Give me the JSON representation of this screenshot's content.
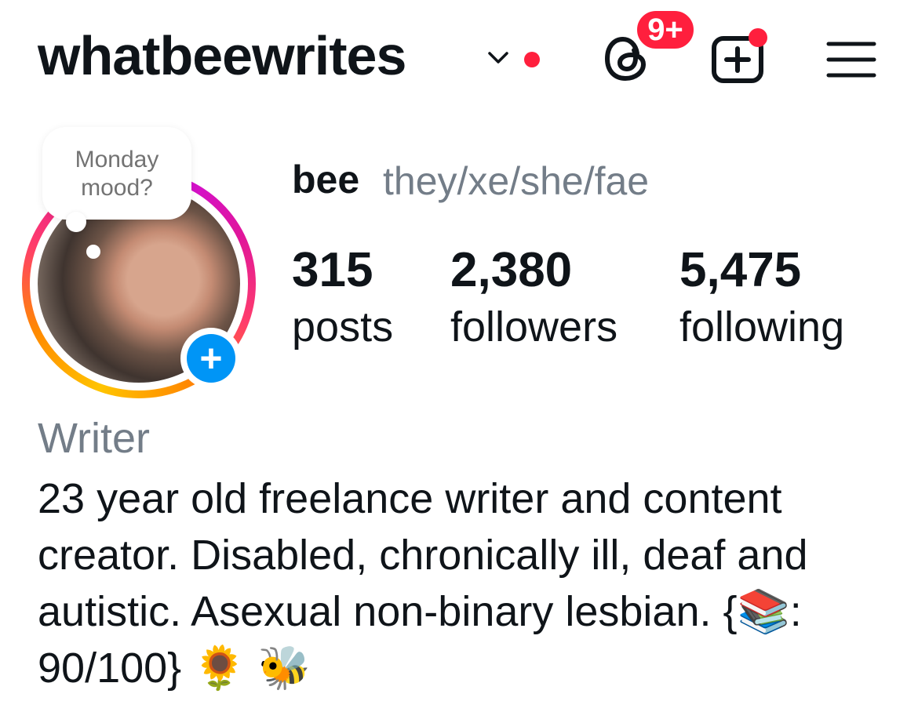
{
  "header": {
    "username": "whatbeewrites",
    "threads_badge": "9+"
  },
  "story_bubble": {
    "text": "Monday mood?"
  },
  "profile": {
    "display_name": "bee",
    "pronouns": "they/xe/she/fae"
  },
  "stats": [
    {
      "value": "315",
      "label": "posts"
    },
    {
      "value": "2,380",
      "label": "followers"
    },
    {
      "value": "5,475",
      "label": "following"
    }
  ],
  "bio": {
    "category": "Writer",
    "text": "23 year old freelance writer and content creator. Disabled, chronically ill, deaf and autistic. Asexual non-binary lesbian. {📚: 90/100} 🌻 🐝"
  },
  "colors": {
    "notification_red": "#ff1f3d",
    "accent_blue": "#0095f6",
    "secondary_text": "#737d88"
  },
  "icons": [
    "chevron-down-icon",
    "threads-icon",
    "new-post-icon",
    "menu-icon",
    "plus-icon"
  ]
}
